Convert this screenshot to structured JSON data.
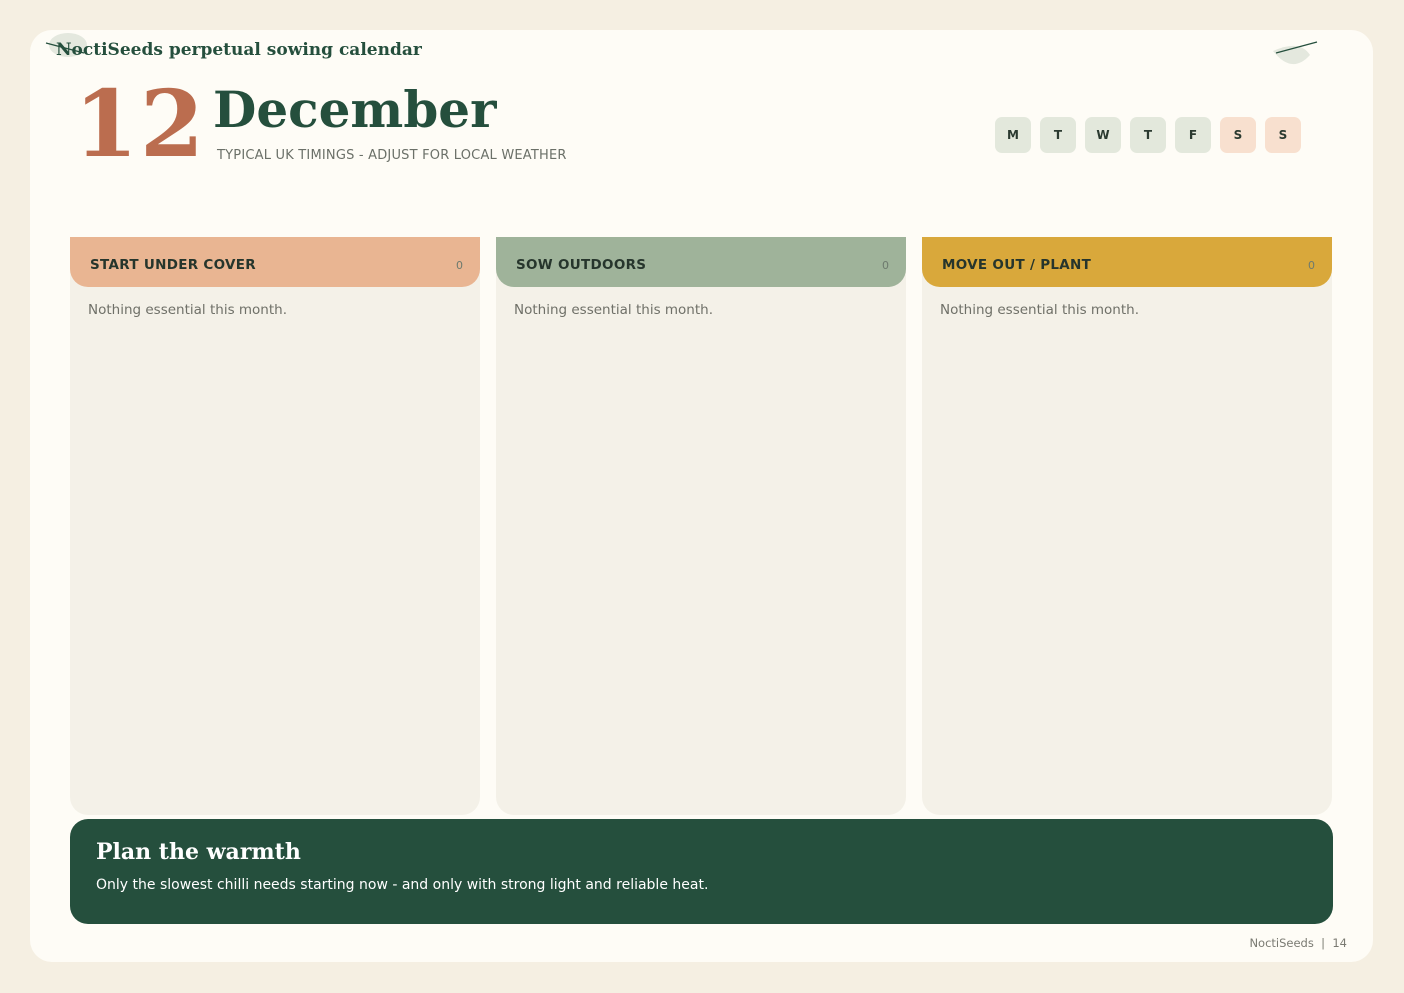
{
  "header": {
    "brand_title": "NoctiSeeds perpetual sowing calendar",
    "day_number": "12",
    "month": "December",
    "subtitle": "TYPICAL UK TIMINGS - ADJUST FOR LOCAL WEATHER"
  },
  "weekdays": [
    "M",
    "T",
    "W",
    "T",
    "F",
    "S",
    "S"
  ],
  "columns": [
    {
      "title": "START UNDER COVER",
      "count": "0",
      "empty_text": "Nothing essential this month.",
      "color": "#e9b592"
    },
    {
      "title": "SOW OUTDOORS",
      "count": "0",
      "empty_text": "Nothing essential this month.",
      "color": "#9fb39a"
    },
    {
      "title": "MOVE OUT / PLANT",
      "count": "0",
      "empty_text": "Nothing essential this month.",
      "color": "#d9a83b"
    }
  ],
  "tip": {
    "title": "Plan the warmth",
    "text": "Only the slowest chilli needs starting now - and only with strong light and reliable heat."
  },
  "footer": {
    "brand": "NoctiSeeds",
    "separator": "|",
    "page_number": "14"
  },
  "colors": {
    "brand_green": "#254f3d",
    "accent_terracotta": "#bb6d4f",
    "page_background": "#fefcf6"
  }
}
